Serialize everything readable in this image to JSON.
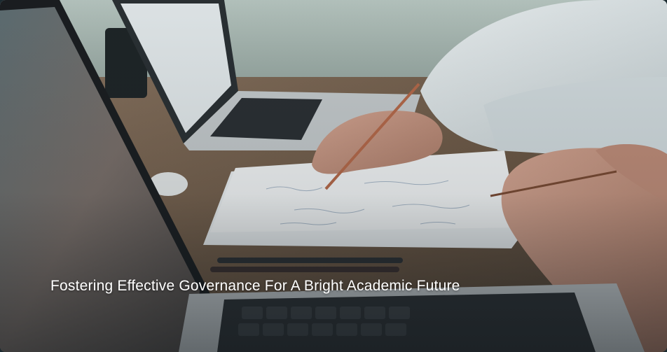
{
  "hero": {
    "caption": "Fostering Effective Governance For A Bright Academic Future",
    "image_subject": "business-meeting-desk-photo"
  },
  "colors": {
    "caption_text": "#ffffff",
    "wall": "#a9b9b3",
    "desk": "#7a6450",
    "shirt": "#dfe7e9"
  }
}
